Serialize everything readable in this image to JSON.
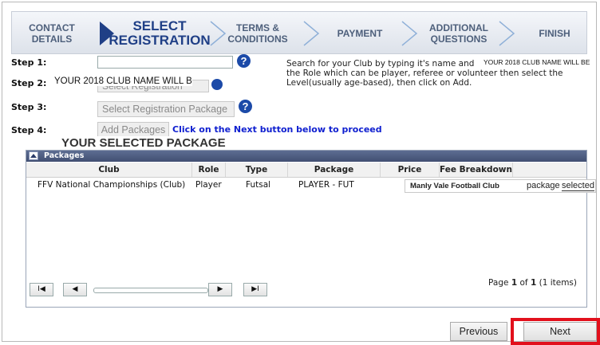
{
  "wizard": {
    "steps": [
      {
        "line1": "CONTACT",
        "line2": "DETAILS"
      },
      {
        "line1": "SELECT",
        "line2": "REGISTRATION"
      },
      {
        "line1": "TERMS &",
        "line2": "CONDITIONS"
      },
      {
        "line1": "PAYMENT",
        "line2": ""
      },
      {
        "line1": "ADDITIONAL",
        "line2": "QUESTIONS"
      },
      {
        "line1": "FINISH",
        "line2": ""
      }
    ],
    "active_index": 1
  },
  "form": {
    "step1_label": "Step 1:",
    "step2_label": "Step 2:",
    "step3_label": "Step 3:",
    "step4_label": "Step 4:",
    "club_input_value": "",
    "help_glyph": "?",
    "hint_text": "Search for your Club by typing it's name and displayed. You then select the Role which can be player, referee or volunteer then select the Level(usually age-based), then click on Add.",
    "overlay_club_name_top": "YOUR 2018 CLUB NAME WILL BE",
    "overlay_club_name_step2": "YOUR 2018 CLUB NAME WILL B",
    "role_select_value": "Select Registration",
    "package_select_value": "Select Registration Package",
    "add_packages_label": "Add Packages",
    "proceed_text": "Click on the Next button below to proceed",
    "selected_package_heading": "YOUR SELECTED PACKAGE"
  },
  "packages": {
    "title": "Packages",
    "columns": [
      "Club",
      "Role",
      "Type",
      "Package",
      "Price",
      "Fee Breakdown"
    ],
    "rows": [
      {
        "club": "FFV National Championships (Club)",
        "role": "Player",
        "type": "Futsal",
        "package": "PLAYER - FUT",
        "price": "",
        "fee_breakdown": ""
      }
    ],
    "overlay_fee": {
      "club": "Manly Vale Football Club",
      "text": "package",
      "selected": "selected"
    },
    "pager": {
      "first": "I◀",
      "prev": "◀",
      "next": "▶",
      "last": "▶I",
      "page_word": "Page",
      "current": "1",
      "of_word": "of",
      "total": "1",
      "items": "(1 items)"
    }
  },
  "footer": {
    "previous_label": "Previous",
    "next_label": "Next"
  },
  "colors": {
    "accent": "#1f3f86",
    "help_icon": "#1c4aa8",
    "panel_header": "#4a5a7e",
    "proceed_text": "#1020d0",
    "highlight": "#e2101c"
  }
}
